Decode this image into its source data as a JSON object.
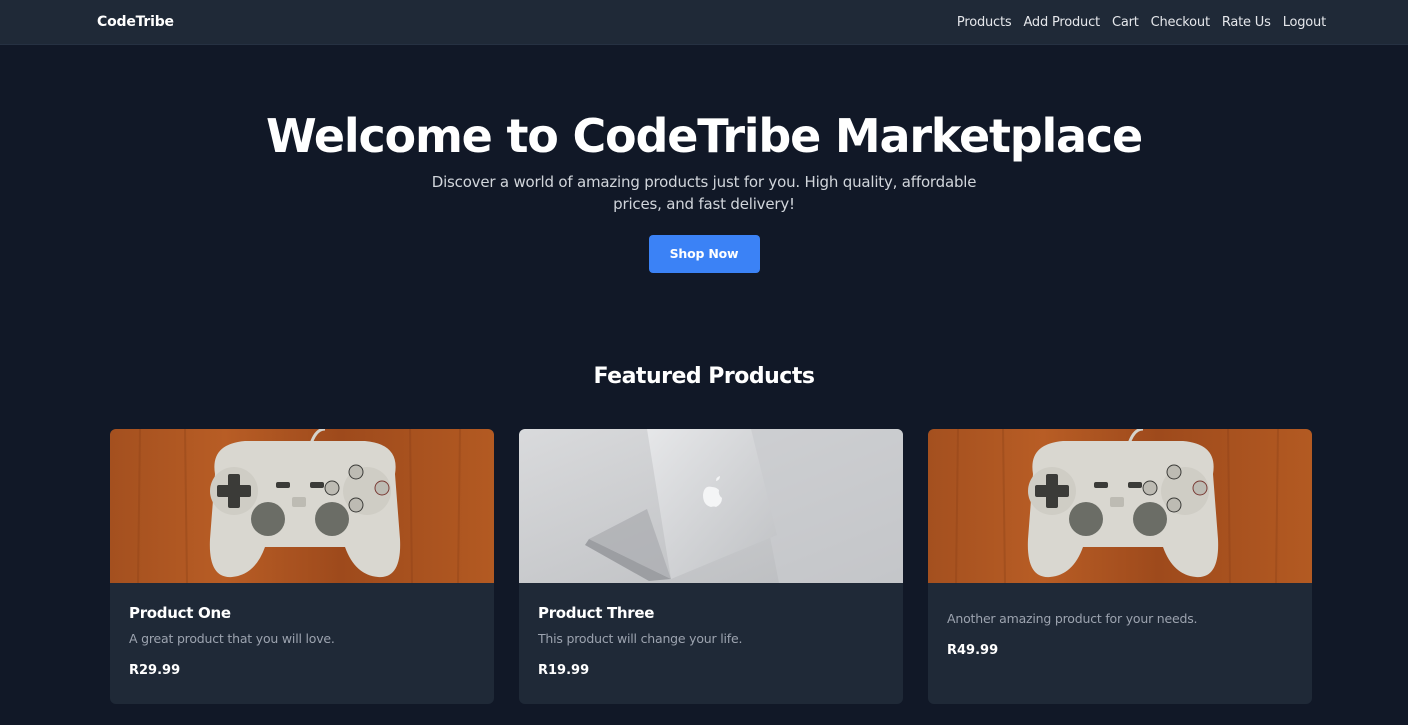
{
  "navbar": {
    "brand": "CodeTribe",
    "links": [
      "Products",
      "Add Product",
      "Cart",
      "Checkout",
      "Rate Us",
      "Logout"
    ]
  },
  "hero": {
    "title": "Welcome to CodeTribe Marketplace",
    "subtitle": "Discover a world of amazing products just for you. High quality, affordable prices, and fast delivery!",
    "cta_label": "Shop Now"
  },
  "featured": {
    "title": "Featured Products",
    "products": [
      {
        "image": "game-controller-image",
        "title": "Product One",
        "description": "A great product that you will love.",
        "price": "R29.99"
      },
      {
        "image": "laptop-image",
        "title": "Product Three",
        "description": "This product will change your life.",
        "price": "R19.99"
      },
      {
        "image": "game-controller-image",
        "title": "",
        "description": "Another amazing product for your needs.",
        "price": "R49.99"
      }
    ]
  },
  "colors": {
    "background": "#111827",
    "navbar": "#1f2937",
    "card": "#1f2937",
    "accent": "#3b82f6",
    "muted_text": "#9ca3af"
  }
}
